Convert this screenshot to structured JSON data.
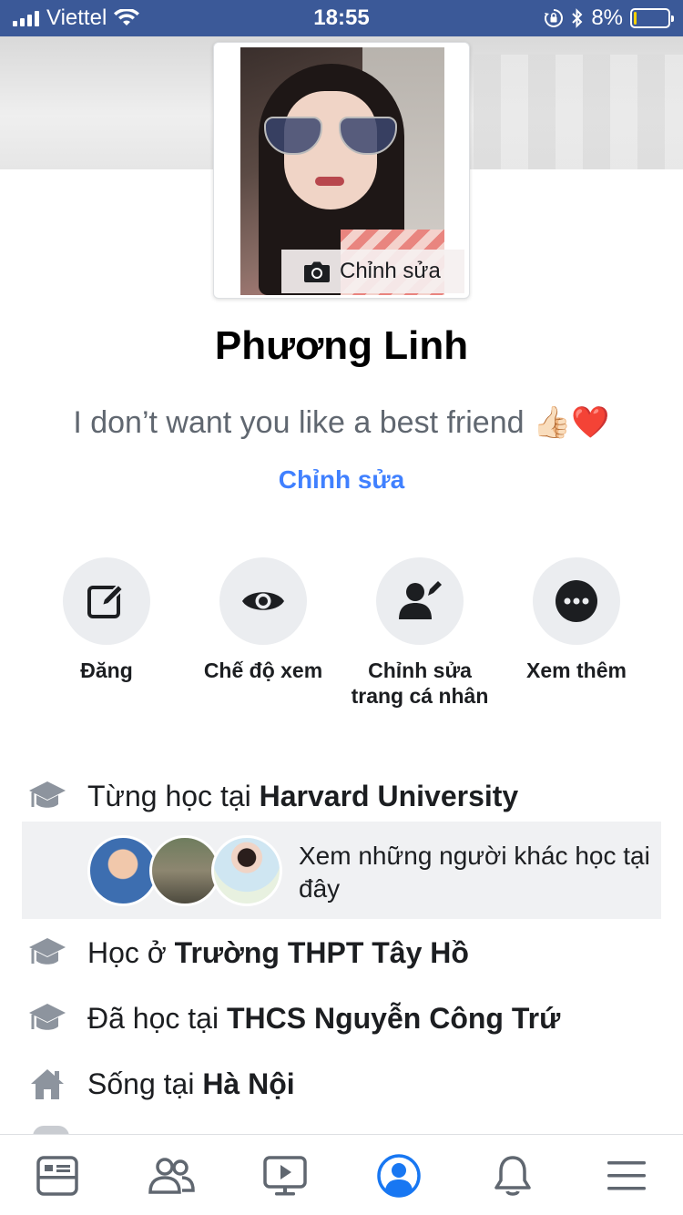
{
  "status_bar": {
    "carrier": "Viettel",
    "time": "18:55",
    "battery": "8%",
    "battery_level": 0.08,
    "icons": [
      "signal-icon",
      "wifi-icon",
      "rotation-lock-icon",
      "bluetooth-icon",
      "battery-icon"
    ]
  },
  "profile": {
    "photo_edit_label": "Chỉnh sửa",
    "name": "Phương Linh",
    "bio": "I don’t want you like a best friend 👍🏻❤️",
    "bio_edit_label": "Chỉnh sửa"
  },
  "actions": [
    {
      "label": "Đăng",
      "icon": "compose-icon"
    },
    {
      "label": "Chế độ xem",
      "icon": "eye-icon"
    },
    {
      "label": "Chỉnh sửa trang cá nhân",
      "icon": "edit-profile-icon"
    },
    {
      "label": "Xem thêm",
      "icon": "more-icon"
    }
  ],
  "info": {
    "harvard": {
      "prefix": "Từng học tại ",
      "value": "Harvard University",
      "icon": "graduation-cap-icon"
    },
    "classmates_text": "Xem những người khác học tại đây",
    "thpt": {
      "prefix": "Học ở ",
      "value": "Trường THPT Tây Hồ",
      "icon": "graduation-cap-icon"
    },
    "thcs": {
      "prefix": "Đã học tại ",
      "value": "THCS Nguyễn Công Trứ",
      "icon": "graduation-cap-icon"
    },
    "lives": {
      "prefix": "Sống tại ",
      "value": "Hà Nội",
      "icon": "home-icon"
    }
  },
  "bottom_nav": [
    "news-feed-icon",
    "friends-icon",
    "watch-icon",
    "profile-icon",
    "notifications-icon",
    "menu-icon"
  ],
  "colors": {
    "status_bar": "#3b5998",
    "link_blue": "#4080ff",
    "active_nav": "#1877f2",
    "icon_gray": "#606770"
  }
}
